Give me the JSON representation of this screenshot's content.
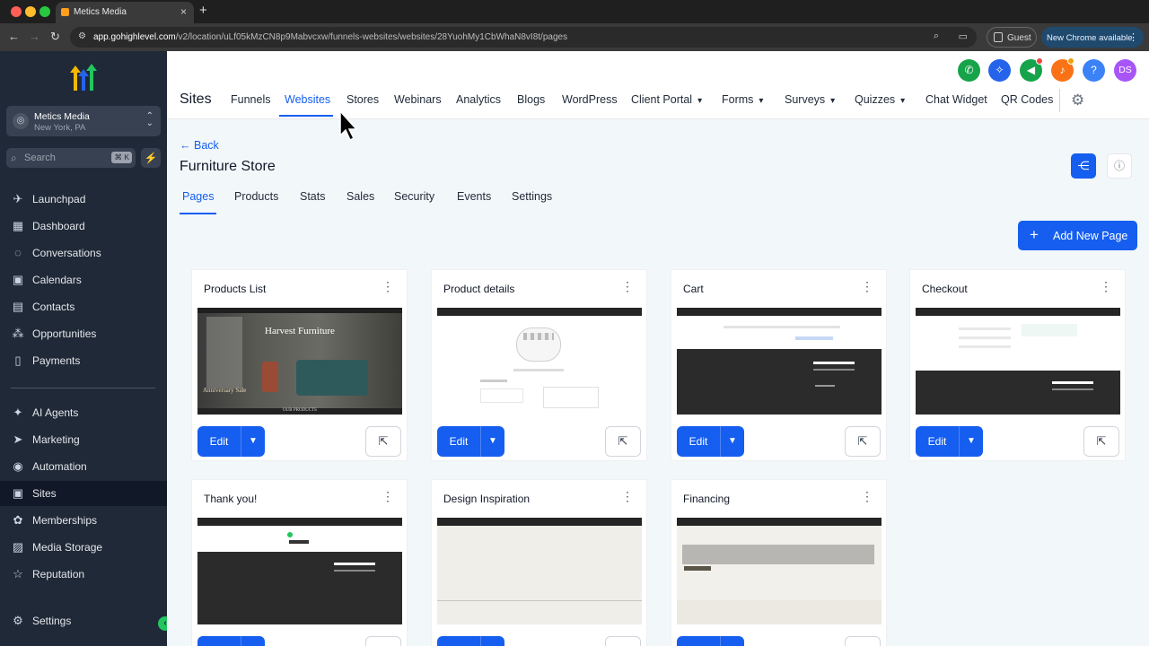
{
  "browser": {
    "tab_title": "Metics Media",
    "url_host": "app.gohighlevel.com",
    "url_path": "/v2/location/uLf05kMzCN8p9Mabvcxw/funnels-websites/websites/28YuohMy1CbWhaN8vI8t/pages",
    "profile": "Guest",
    "update_label": "New Chrome available"
  },
  "sidebar": {
    "location_name": "Metics Media",
    "location_city": "New York, PA",
    "search_placeholder": "Search",
    "search_shortcut": "⌘ K",
    "items": [
      {
        "label": "Launchpad",
        "icon": "rocket-icon"
      },
      {
        "label": "Dashboard",
        "icon": "grid-icon"
      },
      {
        "label": "Conversations",
        "icon": "chat-icon"
      },
      {
        "label": "Calendars",
        "icon": "calendar-icon"
      },
      {
        "label": "Contacts",
        "icon": "contacts-icon"
      },
      {
        "label": "Opportunities",
        "icon": "opportunities-icon"
      },
      {
        "label": "Payments",
        "icon": "payments-icon"
      },
      {
        "label": "AI Agents",
        "icon": "sparkle-icon"
      },
      {
        "label": "Marketing",
        "icon": "send-icon"
      },
      {
        "label": "Automation",
        "icon": "automation-icon"
      },
      {
        "label": "Sites",
        "icon": "sites-icon"
      },
      {
        "label": "Memberships",
        "icon": "memberships-icon"
      },
      {
        "label": "Media Storage",
        "icon": "image-icon"
      },
      {
        "label": "Reputation",
        "icon": "star-icon"
      },
      {
        "label": "Settings",
        "icon": "gear-icon"
      }
    ]
  },
  "header": {
    "section": "Sites",
    "nav": [
      "Funnels",
      "Websites",
      "Stores",
      "Webinars",
      "Analytics",
      "Blogs",
      "WordPress",
      "Client Portal",
      "Forms",
      "Surveys",
      "Quizzes",
      "Chat Widget",
      "QR Codes"
    ],
    "active_nav": "Websites",
    "user_initials": "DS"
  },
  "page": {
    "back_label": "Back",
    "title": "Furniture Store",
    "tabs": [
      "Pages",
      "Products",
      "Stats",
      "Sales",
      "Security",
      "Events",
      "Settings"
    ],
    "active_tab": "Pages",
    "add_button": "Add New Page"
  },
  "cards": [
    {
      "title": "Products List",
      "hero_title": "Harvest Furniture",
      "hero_sub": "Anniversary Sale",
      "hero_footer": "OUR PRODUCTS"
    },
    {
      "title": "Product details"
    },
    {
      "title": "Cart"
    },
    {
      "title": "Checkout"
    },
    {
      "title": "Thank you!"
    },
    {
      "title": "Design Inspiration"
    },
    {
      "title": "Financing"
    }
  ],
  "edit_label": "Edit",
  "colors": {
    "primary": "#155eef",
    "sidebar": "#1f2937",
    "accent_green": "#22c55e"
  }
}
